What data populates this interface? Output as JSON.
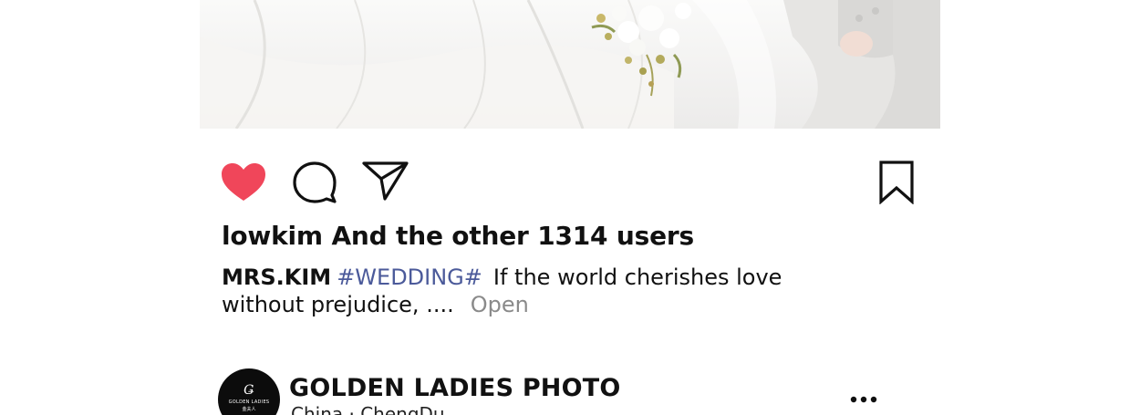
{
  "post": {
    "likes_text": "lowkim And the other 1314 users",
    "caption": {
      "username": "MRS.KIM",
      "hashtag": "#WEDDING#",
      "text": "If the world cherishes love without prejudice, ....",
      "more_label": "Open"
    },
    "icons": {
      "like": "heart-icon",
      "comment": "comment-bubble-icon",
      "share": "paper-plane-icon",
      "save": "bookmark-icon",
      "menu": "more-dots-icon"
    },
    "colors": {
      "like_active": "#f0465a",
      "hashtag": "#4b5a9a",
      "more_label": "#8a8a8a"
    }
  },
  "next_post": {
    "account_name": "GOLDEN LADIES PHOTO",
    "location": "China · ChengDu",
    "avatar": {
      "brand": "GOLDEN LADIES",
      "sub": "金夫人"
    }
  }
}
